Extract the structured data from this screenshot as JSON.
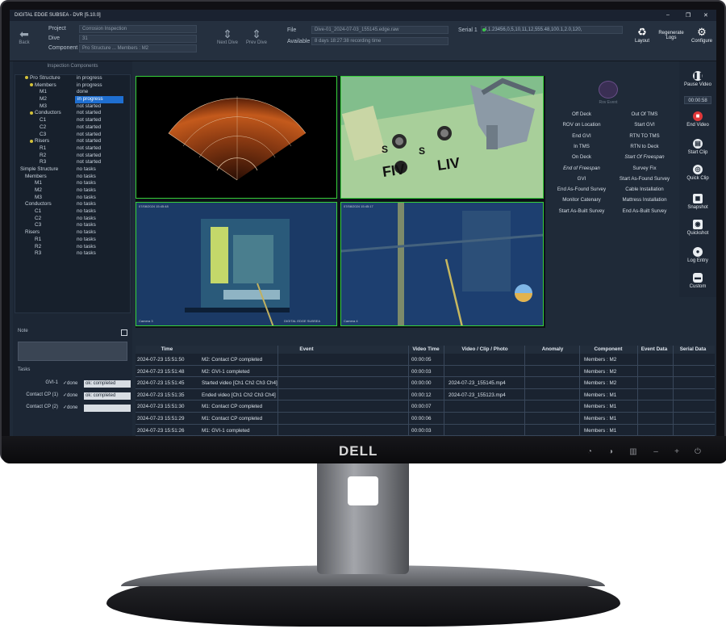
{
  "window": {
    "title": "DIGITAL EDGE SUBSEA - DVR [5.10.0]",
    "controls": [
      "–",
      "❐",
      "✕"
    ]
  },
  "topbar": {
    "back_label": "Back",
    "project_label": "Project",
    "project_value": "Corrosion Inspection",
    "dive_label": "Dive",
    "dive_value": "31",
    "component_label": "Component",
    "component_value": "Pro Structure ... Members : M2",
    "btn_nav_up": "Next Dive",
    "btn_nav_down": "Prev Dive",
    "file_label": "File",
    "file_value": "Dive-01_2024-07-03_155145.edge.raw",
    "available_label": "Available",
    "available_value": "8 days 18:27:38 recording time",
    "serial_label": "Serial 1",
    "serial_value": "4,1.23456,0,5,10,11,12,555.48,100.1,2.0,120,",
    "layout_label": "Layout",
    "regenerate_label": "Regenerate Logs",
    "configure_label": "Configure"
  },
  "leftpanel": {
    "title": "Inspection Components",
    "tree": [
      {
        "label": "Pro Structure",
        "status": "in progress",
        "indent": 1,
        "dot": true
      },
      {
        "label": "Members",
        "status": "in progress",
        "indent": 2,
        "dot": true
      },
      {
        "label": "M1",
        "status": "done",
        "indent": 4
      },
      {
        "label": "M2",
        "status": "in progress",
        "indent": 4,
        "selected": true
      },
      {
        "label": "M3",
        "status": "not started",
        "indent": 4
      },
      {
        "label": "Conductors",
        "status": "not started",
        "indent": 2,
        "dot": true
      },
      {
        "label": "C1",
        "status": "not started",
        "indent": 4
      },
      {
        "label": "C2",
        "status": "not started",
        "indent": 4
      },
      {
        "label": "C3",
        "status": "not started",
        "indent": 4
      },
      {
        "label": "Risers",
        "status": "not started",
        "indent": 2,
        "dot": true
      },
      {
        "label": "R1",
        "status": "not started",
        "indent": 4
      },
      {
        "label": "R2",
        "status": "not started",
        "indent": 4
      },
      {
        "label": "R3",
        "status": "not started",
        "indent": 4
      },
      {
        "label": "Simple Structure",
        "status": "no tasks",
        "indent": 0
      },
      {
        "label": "Members",
        "status": "no tasks",
        "indent": 1
      },
      {
        "label": "M1",
        "status": "no tasks",
        "indent": 3
      },
      {
        "label": "M2",
        "status": "no tasks",
        "indent": 3
      },
      {
        "label": "M3",
        "status": "no tasks",
        "indent": 3
      },
      {
        "label": "Conductors",
        "status": "no tasks",
        "indent": 1
      },
      {
        "label": "C1",
        "status": "no tasks",
        "indent": 3
      },
      {
        "label": "C2",
        "status": "no tasks",
        "indent": 3
      },
      {
        "label": "C3",
        "status": "no tasks",
        "indent": 3
      },
      {
        "label": "Risers",
        "status": "no tasks",
        "indent": 1
      },
      {
        "label": "R1",
        "status": "no tasks",
        "indent": 3
      },
      {
        "label": "R2",
        "status": "no tasks",
        "indent": 3
      },
      {
        "label": "R3",
        "status": "no tasks",
        "indent": 3
      }
    ],
    "note_label": "Note",
    "tasks_label": "Tasks",
    "tasks": [
      {
        "name": "GVI-1",
        "done": "✓done",
        "value": "ok: completed"
      },
      {
        "name": "Contact CP (1)",
        "done": "✓done",
        "value": "ok: completed"
      },
      {
        "name": "Contact CP (2)",
        "done": "✓done",
        "value": ""
      }
    ]
  },
  "video": {
    "cam1_label": "Camera 1",
    "cam3_label": "Camera 3",
    "cam4_label": "Camera 4",
    "overlay_brand": "DIGITAL EDGE SUBSEA"
  },
  "events": {
    "left": [
      "Off Deck",
      "ROV on Location",
      "End GVI",
      "In TMS",
      "On Deck",
      "End of Freespan",
      "GVI",
      "End As-Found Survey",
      "Monitor Catenary",
      "Start As-Built Survey"
    ],
    "right": [
      "Out Of TMS",
      "Start GVI",
      "RTN TO TMS",
      "RTN to Deck",
      "Start Of Freespan",
      "Survey Fix",
      "Start As-Found Survey",
      "Cable Installation",
      "Mattress Installation",
      "End As-Built Survey"
    ],
    "italic_left": [
      5
    ],
    "italic_right": [
      4
    ],
    "logo_caption": "Rov Event"
  },
  "rightbar": {
    "pause": "Pause Video",
    "timer": "00:00:58",
    "end_video": "End Video",
    "start_clip": "Start Clip",
    "quick_clip": "Quick Clip",
    "snapshot": "Snapshot",
    "quickshot": "Quickshot",
    "log_entry": "Log Entry",
    "custom": "Custom"
  },
  "log": {
    "headers": [
      "Time",
      "Event",
      "Video Time",
      "Video / Clip / Photo",
      "Anomaly",
      "Component",
      "Event Data",
      "Serial Data"
    ],
    "rows": [
      [
        "2024-07-23 15:51:50",
        "M2: Contact CP completed",
        "00:00:05",
        "",
        "",
        "Members : M2",
        "",
        ""
      ],
      [
        "2024-07-23 15:51:48",
        "M2: GVI-1 completed",
        "00:00:03",
        "",
        "",
        "Members : M2",
        "",
        ""
      ],
      [
        "2024-07-23 15:51:45",
        "Started video [Ch1 Ch2 Ch3 Ch4]",
        "00:00:00",
        "2024-07-23_155145.mp4",
        "",
        "Members : M2",
        "",
        ""
      ],
      [
        "2024-07-23 15:51:35",
        "Ended video [Ch1 Ch2 Ch3 Ch4]",
        "00:00:12",
        "2024-07-23_155123.mp4",
        "",
        "Members : M1",
        "",
        ""
      ],
      [
        "2024-07-23 15:51:30",
        "M1: Contact CP completed",
        "00:00:07",
        "",
        "",
        "Members : M1",
        "",
        ""
      ],
      [
        "2024-07-23 15:51:29",
        "M1: Contact CP completed",
        "00:00:06",
        "",
        "",
        "Members : M1",
        "",
        ""
      ],
      [
        "2024-07-23 15:51:26",
        "M1: GVI-1 completed",
        "00:00:03",
        "",
        "",
        "Members : M1",
        "",
        ""
      ]
    ]
  },
  "monitor": {
    "brand": "DELL"
  }
}
